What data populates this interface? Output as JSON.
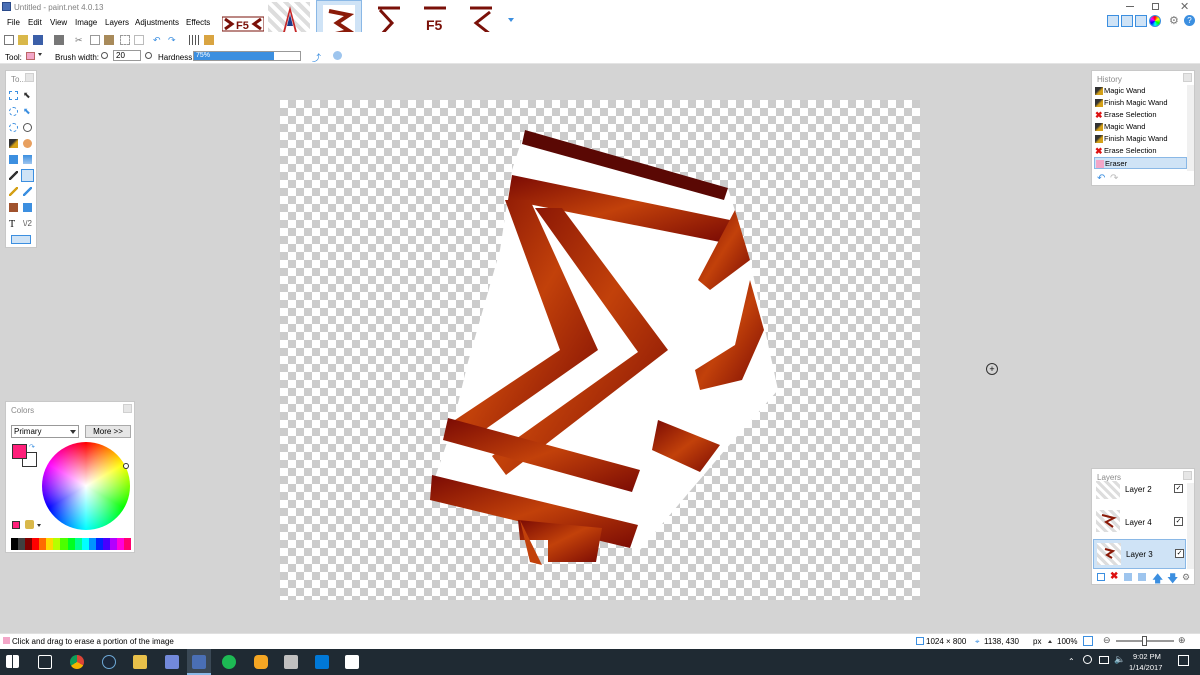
{
  "app": {
    "title": "Untitled - paint.net 4.0.13"
  },
  "menu": [
    "File",
    "Edit",
    "View",
    "Image",
    "Layers",
    "Adjustments",
    "Effects"
  ],
  "toolbar": {
    "tool_label": "Tool:",
    "brush_width_label": "Brush width:",
    "brush_width_value": "20",
    "hardness_label": "Hardness:",
    "hardness_value": "75%",
    "hardness_fraction": 0.75
  },
  "tools_panel": {
    "title": "To..."
  },
  "history": {
    "title": "History",
    "items": [
      {
        "label": "Magic Wand",
        "icon": "magic-wand-icon"
      },
      {
        "label": "Finish Magic Wand",
        "icon": "magic-wand-icon"
      },
      {
        "label": "Erase Selection",
        "icon": "red-x-icon"
      },
      {
        "label": "Magic Wand",
        "icon": "magic-wand-icon"
      },
      {
        "label": "Finish Magic Wand",
        "icon": "magic-wand-icon"
      },
      {
        "label": "Erase Selection",
        "icon": "red-x-icon"
      },
      {
        "label": "Eraser",
        "icon": "eraser-icon",
        "selected": true
      }
    ]
  },
  "colors": {
    "title": "Colors",
    "mode": "Primary",
    "more_button": "More >>",
    "primary": "#ff1f7a",
    "secondary": "#ffffff",
    "palette": [
      "#000000",
      "#404040",
      "#7f0000",
      "#ff0000",
      "#ff6a00",
      "#ffd800",
      "#b6ff00",
      "#4cff00",
      "#00ff21",
      "#00ff90",
      "#00ffff",
      "#0094ff",
      "#0026ff",
      "#4800ff",
      "#b200ff",
      "#ff00dc",
      "#ff006e"
    ]
  },
  "layers": {
    "title": "Layers",
    "items": [
      {
        "label": "Layer 2",
        "checked": true
      },
      {
        "label": "Layer 4",
        "checked": true
      },
      {
        "label": "Layer 3",
        "checked": true,
        "selected": true
      }
    ]
  },
  "status": {
    "hint": "Click and drag to erase a portion of the image",
    "size": "1024 × 800",
    "cursor": "1138, 430",
    "unit": "px",
    "zoom": "100%"
  },
  "taskbar": {
    "time": "9:02 PM",
    "date": "1/14/2017"
  },
  "accent": "#3c8fe0"
}
